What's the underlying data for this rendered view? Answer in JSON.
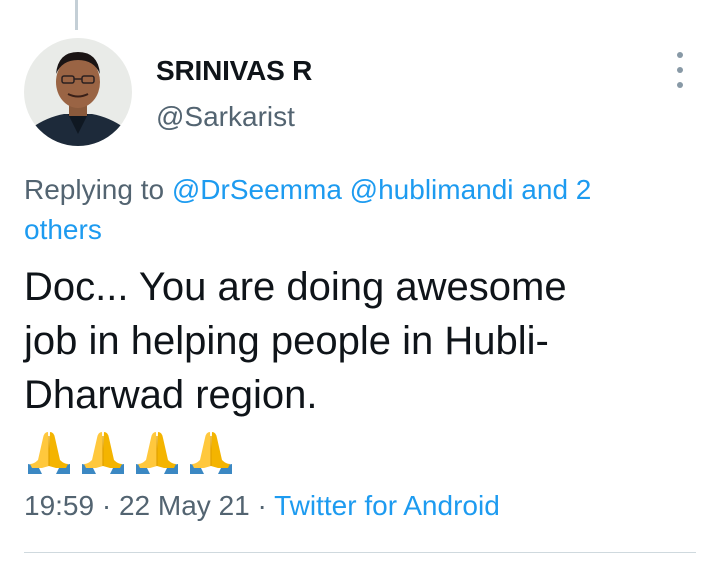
{
  "tweet": {
    "author": {
      "display_name": "SRINIVAS R",
      "handle": "@Sarkarist"
    },
    "replying_to": {
      "prefix": "Replying to",
      "mentions": [
        "@DrSeemma",
        "@hublimandi"
      ],
      "and_others_line1": "and 2",
      "and_others_line2": "others"
    },
    "text": {
      "line1": "Doc... You are doing awesome",
      "line2": "job in helping people in Hubli-",
      "line3": "Dharwad region."
    },
    "emojis": [
      "folded-hands-icon",
      "folded-hands-icon",
      "folded-hands-icon",
      "folded-hands-icon"
    ],
    "meta": {
      "time": "19:59",
      "separator": " · ",
      "date": "22 May 21",
      "source": "Twitter for Android"
    },
    "more_icon": "more-vertical-icon"
  },
  "colors": {
    "text_primary": "#0f1419",
    "text_secondary": "#536471",
    "link": "#1d9bf0",
    "divider": "#cfd9de"
  }
}
